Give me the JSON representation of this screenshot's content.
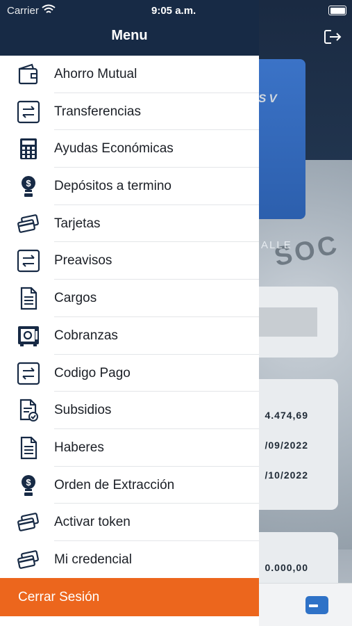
{
  "status_bar": {
    "carrier": "Carrier",
    "time": "9:05 a.m."
  },
  "menu": {
    "title": "Menu",
    "items": [
      {
        "label": "Ahorro Mutual",
        "icon": "wallet-icon"
      },
      {
        "label": "Transferencias",
        "icon": "transfer-arrows-icon"
      },
      {
        "label": "Ayudas Económicas",
        "icon": "calculator-icon"
      },
      {
        "label": "Depósitos a termino",
        "icon": "money-bulb-icon"
      },
      {
        "label": "Tarjetas",
        "icon": "cards-icon"
      },
      {
        "label": "Preavisos",
        "icon": "transfer-arrows-icon"
      },
      {
        "label": "Cargos",
        "icon": "document-icon"
      },
      {
        "label": "Cobranzas",
        "icon": "safe-icon"
      },
      {
        "label": "Codigo Pago",
        "icon": "transfer-arrows-icon"
      },
      {
        "label": "Subsidios",
        "icon": "document-check-icon"
      },
      {
        "label": "Haberes",
        "icon": "document-icon"
      },
      {
        "label": "Orden de Extracción",
        "icon": "money-bulb-icon"
      },
      {
        "label": "Activar token",
        "icon": "cards-icon"
      },
      {
        "label": "Mi credencial",
        "icon": "cards-icon"
      }
    ],
    "logout_label": "Cerrar Sesión"
  },
  "background": {
    "card_logo": "SV",
    "detail_label": "ALLE",
    "watermark": "SOC",
    "values": [
      "4.474,69",
      "/09/2022",
      "/10/2022",
      "0.000,00"
    ]
  },
  "colors": {
    "header": "#172a45",
    "accent": "#ec661d",
    "icon": "#172a45",
    "tab_accent": "#2f72c7"
  }
}
